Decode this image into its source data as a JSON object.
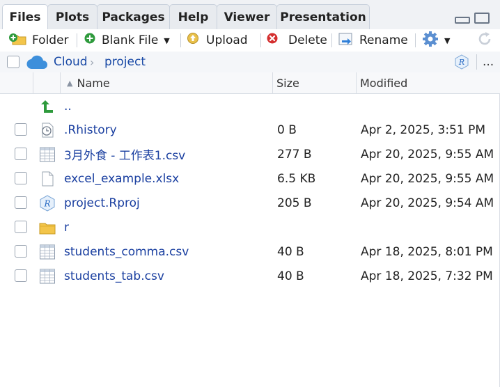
{
  "tabs": [
    {
      "label": "Files",
      "active": true
    },
    {
      "label": "Plots",
      "active": false
    },
    {
      "label": "Packages",
      "active": false
    },
    {
      "label": "Help",
      "active": false
    },
    {
      "label": "Viewer",
      "active": false
    },
    {
      "label": "Presentation",
      "active": false
    }
  ],
  "toolbar": {
    "folder_label": "Folder",
    "blank_file_label": "Blank File",
    "upload_label": "Upload",
    "delete_label": "Delete",
    "rename_label": "Rename",
    "gear_icon": "gear-icon",
    "refresh_icon": "refresh-icon"
  },
  "path": {
    "home_label": "Cloud",
    "current_label": "project",
    "more_label": "..."
  },
  "columns": {
    "name": "Name",
    "size": "Size",
    "modified": "Modified"
  },
  "files": [
    {
      "name": "..",
      "size": "",
      "modified": "",
      "icon": "parent-folder-up-icon"
    },
    {
      "name": ".Rhistory",
      "size": "0 B",
      "modified": "Apr 2, 2025, 3:51 PM",
      "icon": "history-clock-icon"
    },
    {
      "name": "3月外食 - 工作表1.csv",
      "size": "277 B",
      "modified": "Apr 20, 2025, 9:55 AM",
      "icon": "csv-table-icon"
    },
    {
      "name": "excel_example.xlsx",
      "size": "6.5 KB",
      "modified": "Apr 20, 2025, 9:55 AM",
      "icon": "blank-file-icon"
    },
    {
      "name": "project.Rproj",
      "size": "205 B",
      "modified": "Apr 20, 2025, 9:54 AM",
      "icon": "rproj-icon"
    },
    {
      "name": "r",
      "size": "",
      "modified": "",
      "icon": "folder-icon"
    },
    {
      "name": "students_comma.csv",
      "size": "40 B",
      "modified": "Apr 18, 2025, 8:01 PM",
      "icon": "csv-table-icon"
    },
    {
      "name": "students_tab.csv",
      "size": "40 B",
      "modified": "Apr 18, 2025, 7:32 PM",
      "icon": "csv-table-icon"
    }
  ],
  "colors": {
    "link": "#1a3fa0",
    "tab_bg": "#e8ebef",
    "accent_green": "#2e9a3c"
  }
}
